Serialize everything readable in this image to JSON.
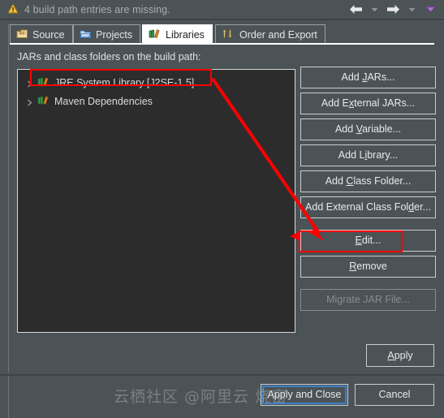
{
  "statusbar": {
    "icon": "warning-triangle-icon",
    "message": "4 build path entries are missing.",
    "nav": {
      "back_icon": "arrow-left-icon",
      "back_menu_icon": "chevron-down-icon",
      "forward_icon": "arrow-right-icon",
      "forward_menu_icon": "chevron-down-icon",
      "overflow_icon": "triangle-down-icon"
    }
  },
  "tabs": [
    {
      "label": "Source",
      "icon": "source-folder-icon",
      "active": false
    },
    {
      "label": "Projects",
      "icon": "project-folder-icon",
      "active": false
    },
    {
      "label": "Libraries",
      "icon": "library-books-icon",
      "active": true
    },
    {
      "label": "Order and Export",
      "icon": "order-arrows-icon",
      "active": false
    }
  ],
  "main": {
    "list_label": "JARs and class folders on the build path:",
    "tree": [
      {
        "label": "JRE System Library [J2SE-1.5]",
        "icon": "library-books-icon",
        "twisty": "chevron-right-icon",
        "highlighted": true
      },
      {
        "label": "Maven Dependencies",
        "icon": "library-books-icon",
        "twisty": "chevron-right-icon",
        "highlighted": false
      }
    ],
    "buttons": [
      {
        "label": "Add JARs...",
        "mnemonic": "J",
        "disabled": false,
        "highlighted": false,
        "gap": false
      },
      {
        "label": "Add External JARs...",
        "mnemonic": "x",
        "disabled": false,
        "highlighted": false,
        "gap": false
      },
      {
        "label": "Add Variable...",
        "mnemonic": "V",
        "disabled": false,
        "highlighted": false,
        "gap": false
      },
      {
        "label": "Add Library...",
        "mnemonic": "i",
        "disabled": false,
        "highlighted": false,
        "gap": false
      },
      {
        "label": "Add Class Folder...",
        "mnemonic": "C",
        "disabled": false,
        "highlighted": false,
        "gap": false
      },
      {
        "label": "Add External Class Folder...",
        "mnemonic": "d",
        "disabled": false,
        "highlighted": false,
        "gap": false
      },
      {
        "label": "Edit...",
        "mnemonic": "E",
        "disabled": false,
        "highlighted": true,
        "gap": true
      },
      {
        "label": "Remove",
        "mnemonic": "R",
        "disabled": false,
        "highlighted": false,
        "gap": false
      },
      {
        "label": "Migrate JAR File...",
        "mnemonic": "",
        "disabled": true,
        "highlighted": false,
        "gap": true
      }
    ],
    "apply_label": "Apply",
    "apply_mnemonic": "A"
  },
  "footer": {
    "apply_and_close_label": "Apply and Close",
    "cancel_label": "Cancel"
  },
  "annotation": {
    "color": "#fe0000",
    "arrow_icon": "red-arrow-annotation",
    "boxes": [
      "tree-item-jre-system-library",
      "edit-button"
    ]
  },
  "watermark": {
    "text": "云栖社区 @阿里云 烧窑"
  },
  "colors": {
    "dialog_bg": "#4c5356",
    "tree_bg": "#2c2c2c",
    "tab_active_bg": "#ffffff",
    "border": "#c9cdce",
    "focus_ring": "#3d80c4",
    "annotation_red": "#fe0000",
    "warning_yellow": "#e8b33a"
  }
}
